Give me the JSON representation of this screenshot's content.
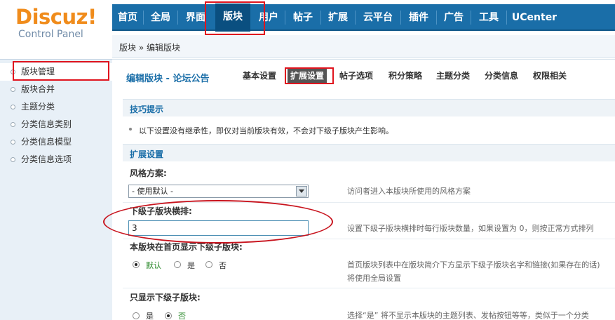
{
  "logo": {
    "main": "Discuz!",
    "sub": "Control Panel"
  },
  "nav": {
    "items": [
      {
        "label": "首页"
      },
      {
        "label": "全局"
      },
      {
        "label": "界面"
      },
      {
        "label": "版块"
      },
      {
        "label": "用户"
      },
      {
        "label": "帖子"
      },
      {
        "label": "扩展"
      },
      {
        "label": "云平台"
      },
      {
        "label": "插件"
      },
      {
        "label": "广告"
      },
      {
        "label": "工具"
      },
      {
        "label": "UCenter"
      }
    ],
    "active": "版块"
  },
  "breadcrumb": "版块 » 编辑版块",
  "sidebar": {
    "items": [
      {
        "label": "版块管理"
      },
      {
        "label": "版块合并"
      },
      {
        "label": "主题分类"
      },
      {
        "label": "分类信息类别"
      },
      {
        "label": "分类信息模型"
      },
      {
        "label": "分类信息选项"
      }
    ],
    "active": "版块管理"
  },
  "page": {
    "title": "编辑版块 - 论坛公告",
    "tabs": [
      {
        "label": "基本设置"
      },
      {
        "label": "扩展设置"
      },
      {
        "label": "帖子选项"
      },
      {
        "label": "积分策略"
      },
      {
        "label": "主题分类"
      },
      {
        "label": "分类信息"
      },
      {
        "label": "权限相关"
      }
    ],
    "active_tab": "扩展设置"
  },
  "tips": {
    "title": "技巧提示",
    "text": "以下设置没有继承性，即仅对当前版块有效，不会对下级子版块产生影响。"
  },
  "ext": {
    "title": "扩展设置",
    "style_label": "风格方案:",
    "style_value": "- 使用默认 -",
    "style_desc": "访问者进入本版块所使用的风格方案",
    "sub_cols_label": "下级子版块横排:",
    "sub_cols_value": "3",
    "sub_cols_desc": "设置下级子版块横排时每行版块数量，如果设置为 0，则按正常方式排列",
    "show_sub_label": "本版块在首页显示下级子版块:",
    "show_sub_options": [
      "默认",
      "是",
      "否"
    ],
    "show_sub_selected": "默认",
    "show_sub_desc1": "首页版块列表中在版块简介下方显示下级子版块名字和链接(如果存在的话)",
    "show_sub_desc2": "将使用全局设置",
    "only_sub_label": "只显示下级子版块:",
    "only_sub_options": [
      "是",
      "否"
    ],
    "only_sub_selected": "否",
    "only_sub_desc": "选择“是” 将不显示本版块的主题列表、发帖按钮等等，类似于一个分类"
  },
  "colors": {
    "nav_bg": "#1a6ea8",
    "logo": "#f08c1c",
    "annotation": "#e0141e"
  }
}
